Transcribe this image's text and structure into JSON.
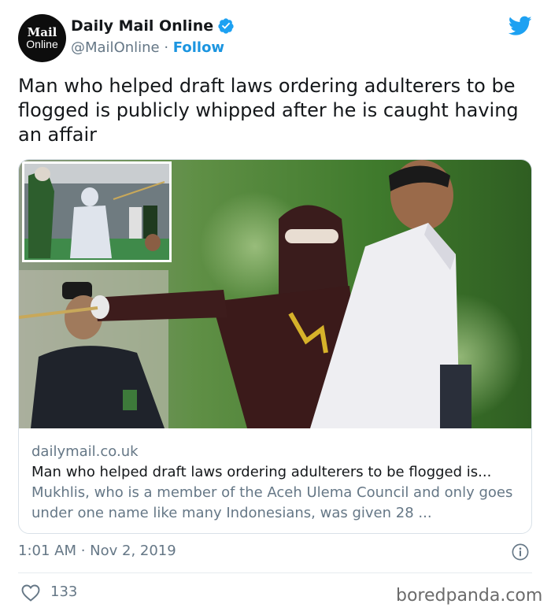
{
  "author": {
    "avatar_line1": "Mail",
    "avatar_line2": "Online",
    "display_name": "Daily Mail Online",
    "handle": "@MailOnline",
    "separator": " · ",
    "follow_label": "Follow"
  },
  "tweet": {
    "text": "Man who helped draft laws ordering adulterers to be flogged is publicly whipped after he is caught having an affair",
    "timestamp": "1:01 AM · Nov 2, 2019",
    "likes": "133"
  },
  "card": {
    "domain": "dailymail.co.uk",
    "title": "Man who helped draft laws ordering adulterers to be flogged is...",
    "description": "Mukhlis, who is a member of the Aceh Ulema Council and only goes under one name like many Indonesians, was given 28 ..."
  },
  "watermark": "boredpanda.com",
  "colors": {
    "accent": "#1b95e0",
    "muted": "#657786",
    "text": "#14171a",
    "border": "#d9e1e8",
    "heart": "#657786"
  },
  "icons": {
    "verified": "verified-badge-icon",
    "brand": "twitter-bird-icon",
    "info": "info-icon",
    "like": "heart-icon"
  }
}
